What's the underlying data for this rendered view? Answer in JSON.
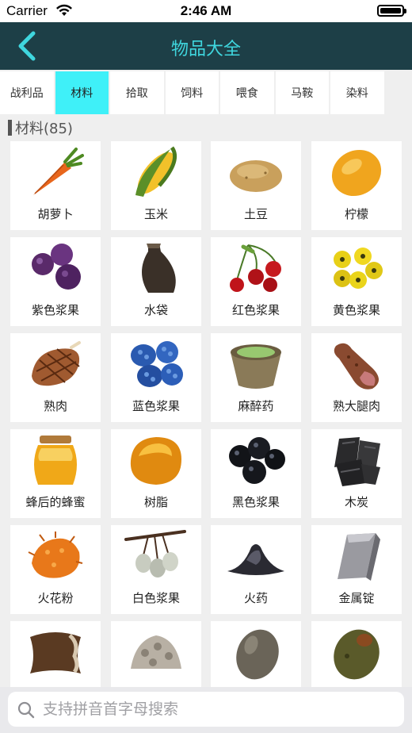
{
  "status": {
    "carrier": "Carrier",
    "time": "2:46 AM"
  },
  "nav": {
    "title": "物品大全"
  },
  "tabs": [
    {
      "label": "战利品",
      "active": false
    },
    {
      "label": "材料",
      "active": true
    },
    {
      "label": "拾取",
      "active": false
    },
    {
      "label": "饲料",
      "active": false
    },
    {
      "label": "喂食",
      "active": false
    },
    {
      "label": "马鞍",
      "active": false
    },
    {
      "label": "染料",
      "active": false
    }
  ],
  "section": {
    "title": "材料(85)"
  },
  "items": [
    {
      "label": "胡萝卜",
      "icon": "carrot-icon"
    },
    {
      "label": "玉米",
      "icon": "corn-icon"
    },
    {
      "label": "土豆",
      "icon": "potato-icon"
    },
    {
      "label": "柠檬",
      "icon": "lemon-icon"
    },
    {
      "label": "紫色浆果",
      "icon": "purple-berry-icon"
    },
    {
      "label": "水袋",
      "icon": "waterskin-icon"
    },
    {
      "label": "红色浆果",
      "icon": "red-berry-icon"
    },
    {
      "label": "黄色浆果",
      "icon": "yellow-berry-icon"
    },
    {
      "label": "熟肉",
      "icon": "cooked-meat-icon"
    },
    {
      "label": "蓝色浆果",
      "icon": "blue-berry-icon"
    },
    {
      "label": "麻醉药",
      "icon": "narcotic-icon"
    },
    {
      "label": "熟大腿肉",
      "icon": "cooked-prime-meat-icon"
    },
    {
      "label": "蜂后的蜂蜜",
      "icon": "honey-icon"
    },
    {
      "label": "树脂",
      "icon": "resin-icon"
    },
    {
      "label": "黑色浆果",
      "icon": "black-berry-icon"
    },
    {
      "label": "木炭",
      "icon": "charcoal-icon"
    },
    {
      "label": "火花粉",
      "icon": "sparkpowder-icon"
    },
    {
      "label": "白色浆果",
      "icon": "white-berry-icon"
    },
    {
      "label": "火药",
      "icon": "gunpowder-icon"
    },
    {
      "label": "金属锭",
      "icon": "metal-ingot-icon"
    },
    {
      "label": "",
      "icon": "hide-icon"
    },
    {
      "label": "",
      "icon": "stone-pile-icon"
    },
    {
      "label": "",
      "icon": "egg-icon"
    },
    {
      "label": "",
      "icon": "green-egg-icon"
    }
  ],
  "search": {
    "placeholder": "支持拼音首字母搜索"
  },
  "colors": {
    "nav_bg": "#1d3f47",
    "accent": "#3fd6de",
    "active_tab": "#3ff0f8"
  }
}
